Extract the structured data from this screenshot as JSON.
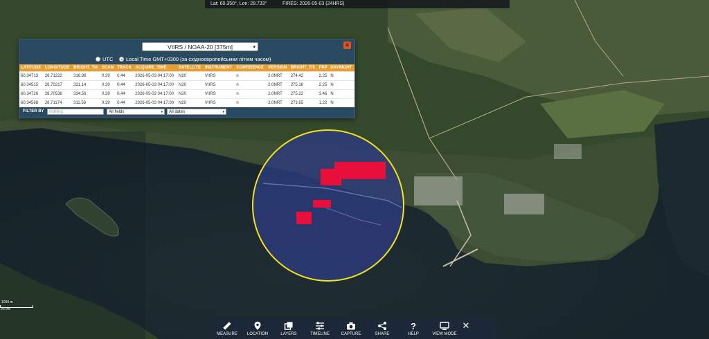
{
  "coords": {
    "latlon": "Lat: 60.350°, Lon: 28.733°",
    "fires": "FIRES: 2026-05-03 (24HRS)"
  },
  "panel": {
    "dataset": "VIIRS / NOAA-20 [375m]",
    "close": "×",
    "tz_utc": "UTC",
    "tz_local": "Local Time GMT+0300 (за східноєвропейським літнім часом)",
    "selected_tz": "local",
    "columns": [
      "LATITUDE",
      "LONGITUDE",
      "BRIGHT_TI4",
      "SCAN",
      "TRACK",
      "ACQUIRE_TIME",
      "SATELLITE",
      "INSTRUMENT",
      "CONFIDENCE",
      "VERSION",
      "BRIGHT_TI5",
      "FRP",
      "DAYNIGHT"
    ],
    "rows": [
      [
        "60.34713",
        "28.71222",
        "316.98",
        "0.39",
        "0.44",
        "2026-05-03 04:17:00",
        "N20",
        "VIIRS",
        "n",
        "2.0NRT",
        "274.42",
        "2.25",
        "N"
      ],
      [
        "60.34515",
        "28.70217",
        "331.14",
        "0.39",
        "0.44",
        "2026-05-03 04:17:00",
        "N20",
        "VIIRS",
        "n",
        "2.0NRT",
        "275.18",
        "2.25",
        "N"
      ],
      [
        "60.34726",
        "28.70538",
        "334.56",
        "0.39",
        "0.44",
        "2026-05-03 04:17:00",
        "N20",
        "VIIRS",
        "n",
        "2.0NRT",
        "275.22",
        "3.46",
        "N"
      ],
      [
        "60.34568",
        "28.71174",
        "311.56",
        "0.39",
        "0.44",
        "2026-05-03 04:17:00",
        "N20",
        "VIIRS",
        "n",
        "2.0NRT",
        "273.65",
        "1.22",
        "N"
      ]
    ],
    "filter": {
      "label": "FILTER BY",
      "placeholder": "nothing",
      "fields": "All fields",
      "dates": "All dates"
    }
  },
  "toolbar": {
    "buttons": [
      {
        "label": "MEASURE",
        "icon": "ruler-icon"
      },
      {
        "label": "LOCATION",
        "icon": "location-pin-icon"
      },
      {
        "label": "LAYERS",
        "icon": "layers-icon"
      },
      {
        "label": "TIMELINE",
        "icon": "sliders-icon"
      },
      {
        "label": "CAPTURE",
        "icon": "camera-icon"
      },
      {
        "label": "SHARE",
        "icon": "share-icon"
      },
      {
        "label": "HELP",
        "icon": "help-icon"
      },
      {
        "label": "VIEW MODE",
        "icon": "monitor-icon"
      }
    ],
    "close": "✕"
  },
  "scale": {
    "km": "1000 m",
    "mi": "0.6 mi"
  },
  "colors": {
    "fire": "#e8103a",
    "circle": "#f4e31a",
    "header": "#e59e2f",
    "panel": "#2a4a62"
  }
}
